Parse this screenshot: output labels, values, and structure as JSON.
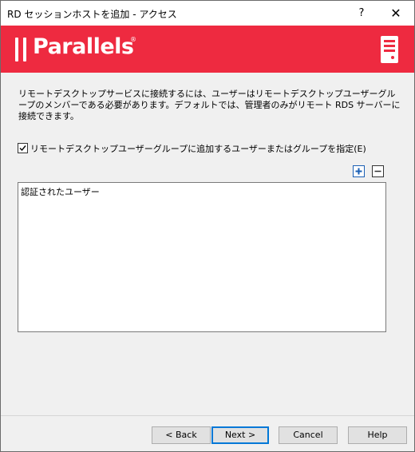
{
  "window": {
    "title": "RD セッションホストを追加 - アクセス",
    "help_glyph": "?",
    "close_glyph": "✕"
  },
  "banner": {
    "logo_text": "Parallels",
    "logo_reg": "®",
    "color": "#ee2a40",
    "icon": "server-icon"
  },
  "description": "リモートデスクトップサービスに接続するには、ユーザーはリモートデスクトップユーザーグループのメンバーである必要があります。デフォルトでは、管理者のみがリモート RDS サーバーに接続できます。",
  "option": {
    "label": "リモートデスクトップユーザーグループに追加するユーザーまたはグループを指定(E)",
    "checked": true
  },
  "toolbar": {
    "add_icon": "plus-icon",
    "remove_icon": "minus-icon"
  },
  "list": {
    "items": [
      "認証されたユーザー"
    ]
  },
  "buttons": {
    "back": "< Back",
    "next": "Next >",
    "cancel": "Cancel",
    "help": "Help"
  }
}
